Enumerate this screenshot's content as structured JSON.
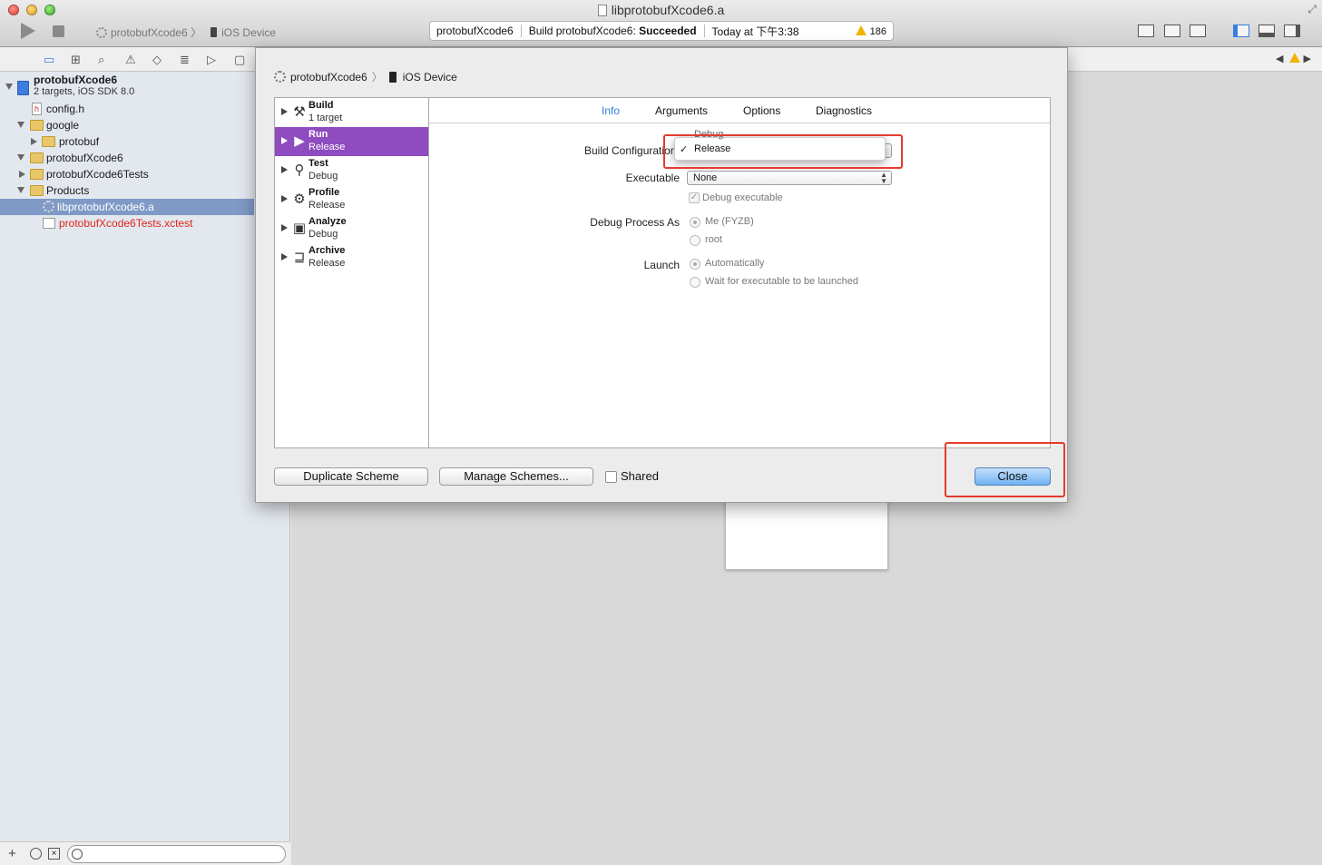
{
  "window": {
    "title": "libprotobufXcode6.a"
  },
  "toolbar": {
    "scheme_name": "protobufXcode6",
    "destination": "iOS Device",
    "activity": {
      "project": "protobufXcode6",
      "status_prefix": "Build protobufXcode6:",
      "status_result": "Succeeded",
      "timestamp": "Today at 下午3:38",
      "warning_count": "186"
    }
  },
  "navigator": {
    "project": {
      "name": "protobufXcode6",
      "subtitle": "2 targets, iOS SDK 8.0"
    },
    "items": [
      {
        "label": "config.h"
      },
      {
        "label": "google"
      },
      {
        "label": "protobuf"
      },
      {
        "label": "protobufXcode6"
      },
      {
        "label": "protobufXcode6Tests"
      },
      {
        "label": "Products"
      },
      {
        "label": "libprotobufXcode6.a"
      },
      {
        "label": "protobufXcode6Tests.xctest"
      }
    ]
  },
  "scheme_editor": {
    "breadcrumb": {
      "scheme": "protobufXcode6",
      "destination": "iOS Device"
    },
    "actions": [
      {
        "name": "Build",
        "sub": "1 target"
      },
      {
        "name": "Run",
        "sub": "Release"
      },
      {
        "name": "Test",
        "sub": "Debug"
      },
      {
        "name": "Profile",
        "sub": "Release"
      },
      {
        "name": "Analyze",
        "sub": "Debug"
      },
      {
        "name": "Archive",
        "sub": "Release"
      }
    ],
    "tabs": [
      "Info",
      "Arguments",
      "Options",
      "Diagnostics"
    ],
    "form": {
      "build_configuration_label": "Build Configuration",
      "build_configuration_options": [
        "Debug",
        "Release"
      ],
      "build_configuration_selected": "Release",
      "executable_label": "Executable",
      "executable_value": "None",
      "debug_executable_label": "Debug executable",
      "debug_process_label": "Debug Process As",
      "debug_process_options": [
        "Me (FYZB)",
        "root"
      ],
      "launch_label": "Launch",
      "launch_options": [
        "Automatically",
        "Wait for executable to be launched"
      ]
    },
    "buttons": {
      "duplicate": "Duplicate Scheme",
      "manage": "Manage Schemes...",
      "shared": "Shared",
      "close": "Close"
    }
  },
  "colors": {
    "accent_purple": "#8f4bc0",
    "tab_active": "#2f7cd6",
    "annotation_red": "#e53b2c",
    "warning": "#f0b400"
  }
}
